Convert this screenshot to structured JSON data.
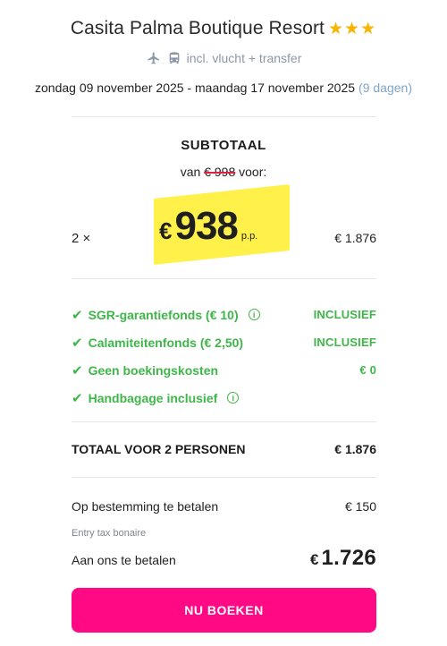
{
  "hotel": {
    "name": "Casita Palma Boutique Resort",
    "stars": "★★★",
    "star_color": "#f7b500"
  },
  "package": {
    "icons": [
      "plane-icon",
      "bus-icon"
    ],
    "label": "incl. vlucht + transfer"
  },
  "dates": {
    "range": "zondag 09 november 2025 - maandag 17 november 2025",
    "duration": "(9 dagen)"
  },
  "subtotal": {
    "title": "SUBTOTAAL",
    "from_prefix": "van",
    "old_price": "€ 998",
    "from_suffix": "voor:",
    "quantity": "2 ×",
    "currency": "€",
    "price": "938",
    "per_person": "p.p.",
    "row_total": "€ 1.876"
  },
  "inclusions": [
    {
      "label": "SGR-garantiefonds (€ 10)",
      "info": "i",
      "value": "INCLUSIEF"
    },
    {
      "label": "Calamiteitenfonds (€ 2,50)",
      "value": "INCLUSIEF"
    },
    {
      "label": "Geen boekingskosten",
      "value": "€ 0"
    },
    {
      "label": "Handbagage inclusief",
      "info": "i",
      "value": ""
    }
  ],
  "total": {
    "label": "TOTAAL VOOR 2 PERSONEN",
    "amount": "€ 1.876"
  },
  "destination": {
    "label": "Op bestemming te betalen",
    "amount": "€ 150",
    "note": "Entry tax bonaire"
  },
  "pay": {
    "label": "Aan ons te betalen",
    "currency": "€",
    "amount": "1.726"
  },
  "cta": {
    "label": "NU BOEKEN",
    "color": "#ff0a84"
  },
  "colors": {
    "accent_green": "#3fb649",
    "highlight_yellow": "#fff04a",
    "strike_red": "#e0203f"
  }
}
